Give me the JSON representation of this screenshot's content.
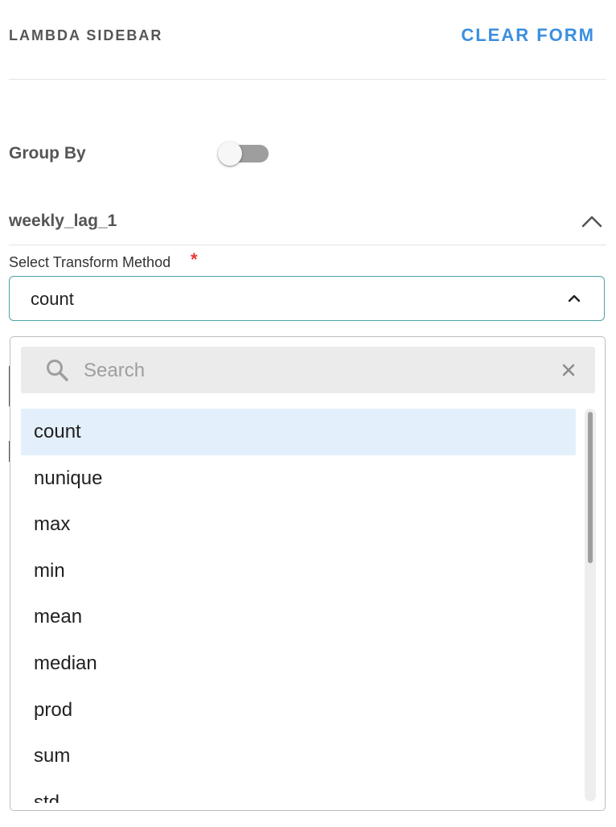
{
  "header": {
    "title": "LAMBDA SIDEBAR",
    "clear_label": "CLEAR FORM",
    "accent_color": "#3b8fe0"
  },
  "group_by": {
    "label": "Group By",
    "enabled": false
  },
  "section": {
    "title": "weekly_lag_1",
    "expanded": true
  },
  "transform_field": {
    "label": "Select Transform Method",
    "required_mark": "*",
    "value": "count",
    "open": true
  },
  "dropdown": {
    "search_placeholder": "Search",
    "search_value": "",
    "options": [
      "count",
      "nunique",
      "max",
      "min",
      "mean",
      "median",
      "prod",
      "sum",
      "std"
    ],
    "selected": "count"
  },
  "icons": {
    "search": "search-icon",
    "clear": "close-icon",
    "section_toggle": "chevron-up-icon",
    "select_toggle": "chevron-up-icon"
  }
}
